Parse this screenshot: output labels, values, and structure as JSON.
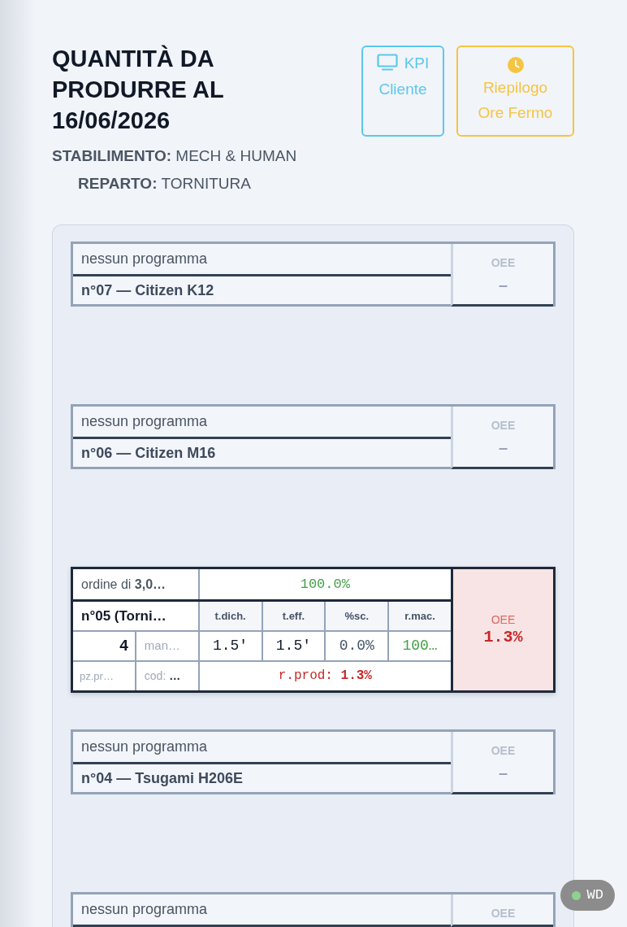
{
  "header": {
    "title": "QUANTITÀ DA PRODURRE AL 16/06/2026",
    "details": [
      "**STABILIMENTO:** MECH & HUMAN",
      "**REPARTO:** TORNITURA"
    ]
  },
  "actions": [
    {
      "kind": "monitor",
      "label": "KPI Cliente",
      "color": "#5bc8ec"
    },
    {
      "kind": "clock",
      "label": "Riepilogo Ore Fermo",
      "color": "#f5c542"
    }
  ],
  "machines": [
    {
      "kind": "idle",
      "program": "nessun programma",
      "name": "n°07 — Citizen K12",
      "oee_label": "OEE",
      "oee_value": "–"
    },
    {
      "kind": "idle",
      "program": "nessun programma",
      "name": "n°06 — Citizen M16",
      "oee_label": "OEE",
      "oee_value": "–"
    },
    {
      "kind": "active",
      "order": "ordine di **3,0…**",
      "progress": {
        "text": "100.0%",
        "color": "#43a047"
      },
      "name": "n°05 (Torni…",
      "columns": [
        "t.dich.",
        "t.eff.",
        "%sc.",
        "r.mac."
      ],
      "row_3": [
        "4",
        "man…"
      ],
      "values": [
        {
          "text": "1.5'",
          "color": "#111827"
        },
        {
          "text": "1.5'",
          "color": "#111827"
        },
        {
          "text": "0.0%",
          "color": "#475569"
        },
        {
          "text": "100…",
          "color": "#43a047"
        }
      ],
      "row_4": [
        "pz.pr…",
        "cod: **…**"
      ],
      "rate": "r.prod: **1.3%**",
      "oee_label": "OEE",
      "oee_value": "1.3%",
      "oee_alert": true
    },
    {
      "kind": "idle",
      "program": "nessun programma",
      "name": "n°04 — Tsugami H206E",
      "oee_label": "OEE",
      "oee_value": "–"
    },
    {
      "kind": "idle",
      "program": "nessun programma",
      "oee_label": "OEE"
    }
  ],
  "status_badge": {
    "label": "WD",
    "online": true
  }
}
